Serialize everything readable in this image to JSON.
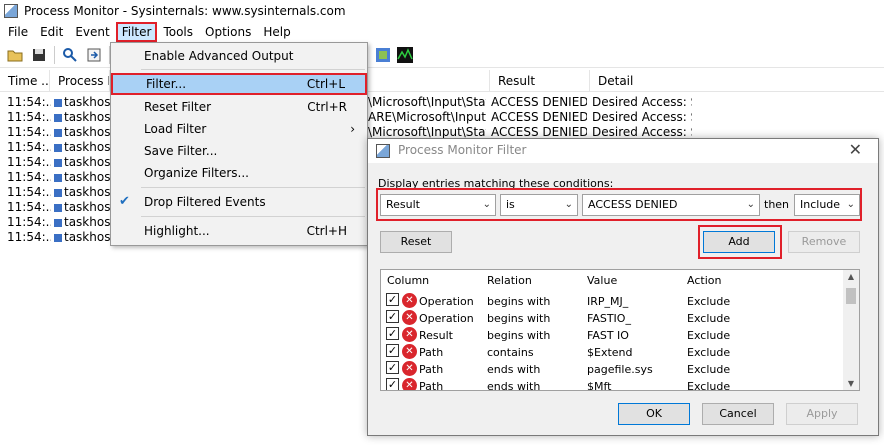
{
  "window": {
    "title": "Process Monitor - Sysinternals: www.sysinternals.com"
  },
  "menubar": [
    "File",
    "Edit",
    "Event",
    "Filter",
    "Tools",
    "Options",
    "Help"
  ],
  "toolbar_icons": [
    "open-icon",
    "save-icon",
    "find-icon",
    "jump-icon",
    "filter-icon",
    "registry-icon",
    "network-icon"
  ],
  "grid": {
    "columns": [
      "Time ...",
      "Process Na",
      "Result",
      "Detail"
    ],
    "rows": [
      {
        "time": "11:54:...",
        "process": "taskhostw",
        "path": "\\Microsoft\\Input\\State",
        "result": "ACCESS DENIED",
        "detail": "Desired Access: S..."
      },
      {
        "time": "11:54:...",
        "process": "taskhostw",
        "path": "ARE\\Microsoft\\Input\\Sta...",
        "result": "ACCESS DENIED",
        "detail": "Desired Access: S..."
      },
      {
        "time": "11:54:...",
        "process": "taskhostw",
        "path": "\\Microsoft\\Input\\State",
        "result": "ACCESS DENIED",
        "detail": "Desired Access: S..."
      },
      {
        "time": "11:54:...",
        "process": "taskhostw",
        "path": "",
        "result": "",
        "detail": ""
      },
      {
        "time": "11:54:...",
        "process": "taskhostw",
        "path": "",
        "result": "",
        "detail": ""
      },
      {
        "time": "11:54:...",
        "process": "taskhostw",
        "path": "",
        "result": "",
        "detail": ""
      },
      {
        "time": "11:54:...",
        "process": "taskhostw",
        "path": "",
        "result": "",
        "detail": ""
      },
      {
        "time": "11:54:...",
        "process": "taskhostw",
        "path": "",
        "result": "",
        "detail": ""
      },
      {
        "time": "11:54:...",
        "process": "taskhostw",
        "path": "",
        "result": "",
        "detail": ""
      },
      {
        "time": "11:54:...",
        "process": "taskhostw",
        "path": "",
        "result": "",
        "detail": ""
      }
    ]
  },
  "filter_menu": {
    "items": [
      {
        "label": "Enable Advanced Output",
        "shortcut": ""
      },
      {
        "label": "Filter...",
        "shortcut": "Ctrl+L"
      },
      {
        "label": "Reset Filter",
        "shortcut": "Ctrl+R"
      },
      {
        "label": "Load Filter",
        "shortcut": ""
      },
      {
        "label": "Save Filter...",
        "shortcut": ""
      },
      {
        "label": "Organize Filters...",
        "shortcut": ""
      },
      {
        "label": "Drop Filtered Events",
        "shortcut": ""
      },
      {
        "label": "Highlight...",
        "shortcut": "Ctrl+H"
      }
    ],
    "submenu_arrow": "›",
    "check": "✔"
  },
  "dialog": {
    "title": "Process Monitor Filter",
    "close": "✕",
    "prompt": "Display entries matching these conditions:",
    "column_value": "Result",
    "relation_value": "is",
    "value_text": "ACCESS DENIED",
    "then_label": "then",
    "action_value": "Include",
    "reset_label": "Reset",
    "add_label": "Add",
    "remove_label": "Remove",
    "ok_label": "OK",
    "cancel_label": "Cancel",
    "apply_label": "Apply",
    "list_headers": [
      "Column",
      "Relation",
      "Value",
      "Action"
    ],
    "list_rows": [
      {
        "column": "Operation",
        "relation": "begins with",
        "value": "IRP_MJ_",
        "action": "Exclude"
      },
      {
        "column": "Operation",
        "relation": "begins with",
        "value": "FASTIO_",
        "action": "Exclude"
      },
      {
        "column": "Result",
        "relation": "begins with",
        "value": "FAST IO",
        "action": "Exclude"
      },
      {
        "column": "Path",
        "relation": "contains",
        "value": "$Extend",
        "action": "Exclude"
      },
      {
        "column": "Path",
        "relation": "ends with",
        "value": "pagefile.sys",
        "action": "Exclude"
      },
      {
        "column": "Path",
        "relation": "ends with",
        "value": "$Mft",
        "action": "Exclude"
      }
    ]
  },
  "colors": {
    "highlight_red": "#e0202a",
    "menu_hover": "#a9d1f5",
    "error_red": "#d9262d"
  }
}
